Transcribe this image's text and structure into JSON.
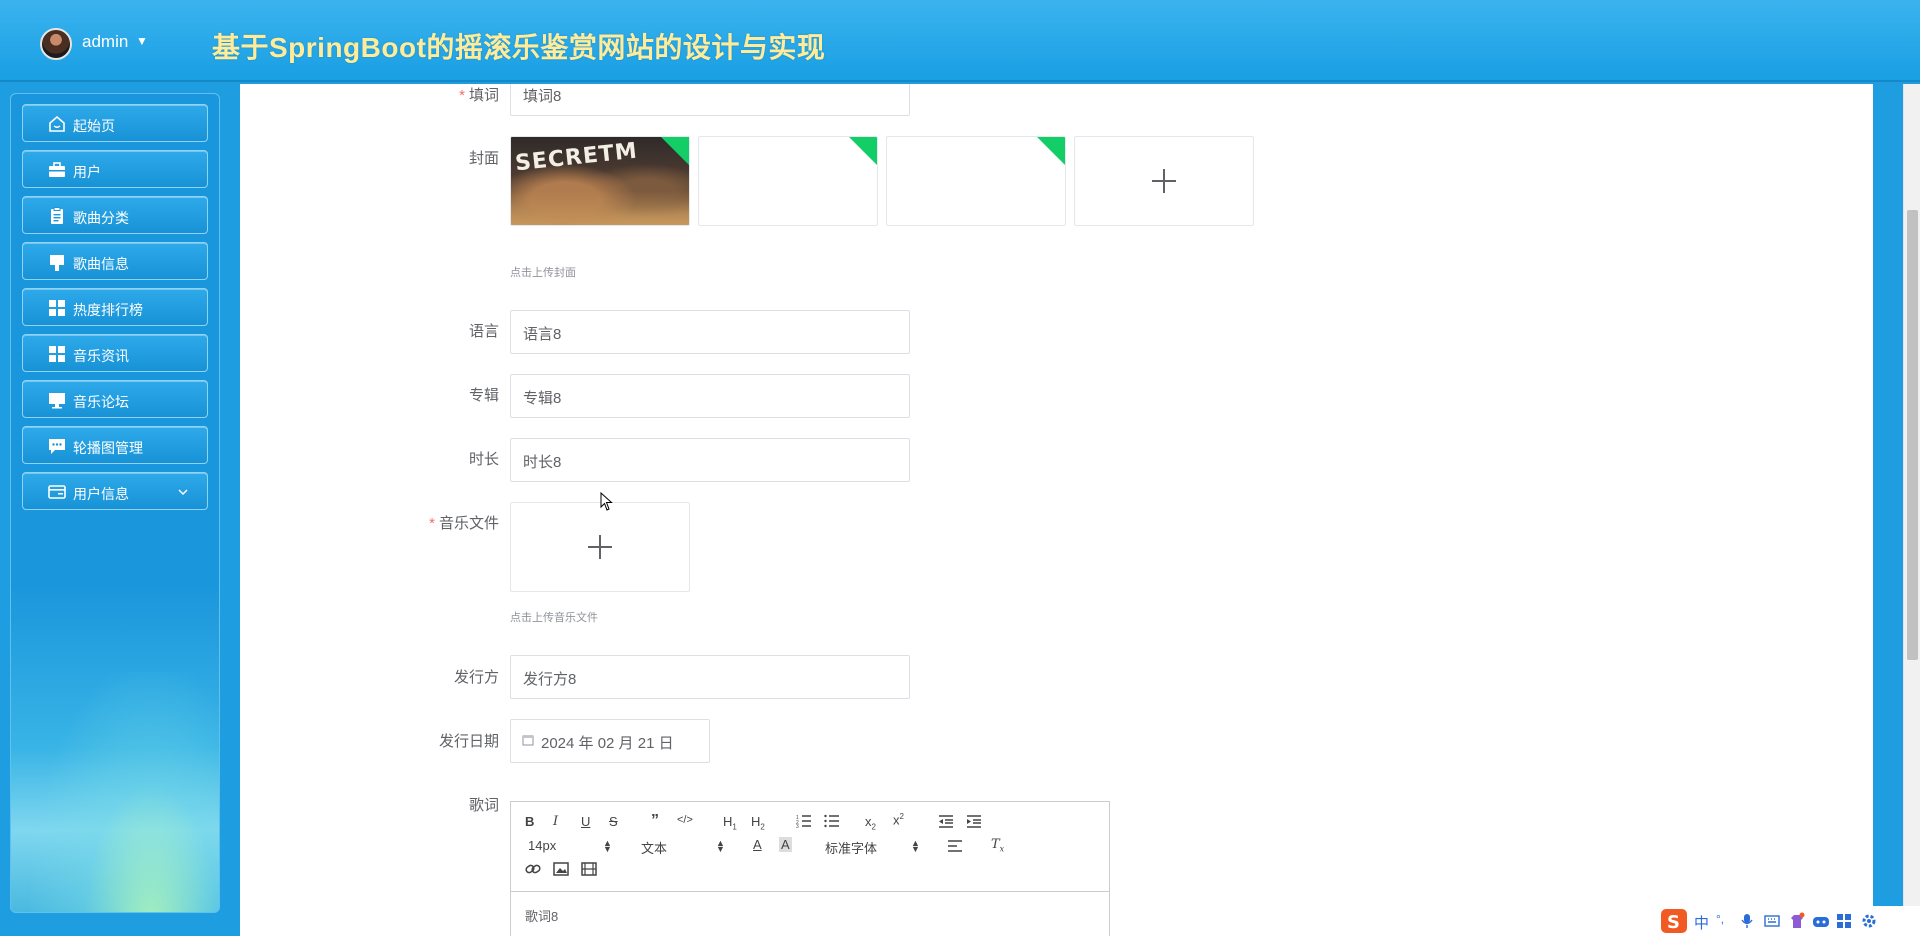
{
  "header": {
    "user": "admin",
    "title": "基于SpringBoot的摇滚乐鉴赏网站的设计与实现"
  },
  "sidebar": {
    "items": [
      {
        "label": "起始页",
        "icon": "home-icon"
      },
      {
        "label": "用户",
        "icon": "briefcase-icon"
      },
      {
        "label": "歌曲分类",
        "icon": "clipboard-icon"
      },
      {
        "label": "歌曲信息",
        "icon": "brush-icon"
      },
      {
        "label": "热度排行榜",
        "icon": "grid-icon"
      },
      {
        "label": "音乐资讯",
        "icon": "grid-icon"
      },
      {
        "label": "音乐论坛",
        "icon": "monitor-icon"
      },
      {
        "label": "轮播图管理",
        "icon": "chat-icon"
      },
      {
        "label": "用户信息",
        "icon": "card-icon"
      }
    ]
  },
  "form": {
    "lyricist": {
      "label": "填词",
      "value": "填词8"
    },
    "cover": {
      "label": "封面",
      "tip": "点击上传封面",
      "image_text": "SECRETM"
    },
    "language": {
      "label": "语言",
      "value": "语言8"
    },
    "album": {
      "label": "专辑",
      "value": "专辑8"
    },
    "duration": {
      "label": "时长",
      "value": "时长8"
    },
    "music_file": {
      "label": "音乐文件",
      "tip": "点击上传音乐文件"
    },
    "publisher": {
      "label": "发行方",
      "value": "发行方8"
    },
    "release_date": {
      "label": "发行日期",
      "value": "2024 年 02 月 21 日"
    },
    "lyrics": {
      "label": "歌词",
      "font_size": "14px",
      "header_select": "文本",
      "font_family": "标准字体",
      "content": "歌词8"
    }
  },
  "required_mark": "*",
  "ime": {
    "mode": "中",
    "punct": "°,"
  }
}
